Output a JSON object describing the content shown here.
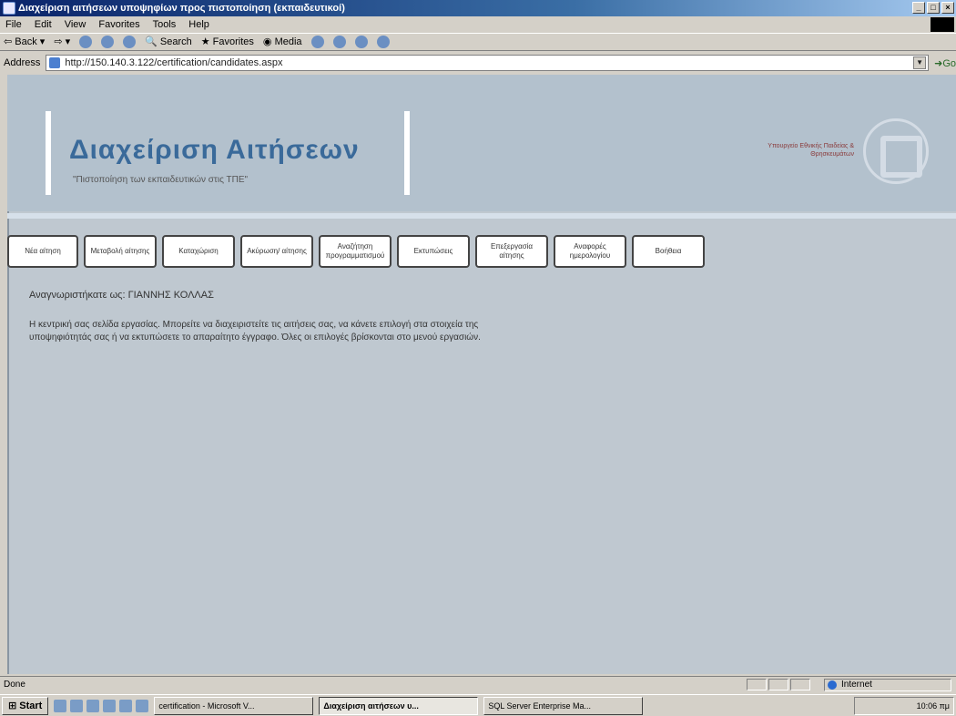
{
  "window": {
    "title": "Διαχείριση αιτήσεων υποψηφίων προς πιστοποίηση (εκπαιδευτικοί)",
    "controls": [
      "_",
      "□",
      "×"
    ]
  },
  "menu": [
    "File",
    "Edit",
    "View",
    "Favorites",
    "Tools",
    "Help"
  ],
  "toolbar": {
    "back": "Back",
    "search": "Search",
    "favorites": "Favorites",
    "media": "Media"
  },
  "address": {
    "label": "Address",
    "url": "http://150.140.3.122/certification/candidates.aspx",
    "go": "Go"
  },
  "header": {
    "title": "Διαχείριση Αιτήσεων",
    "subtitle": "\"Πιστοποίηση των εκπαιδευτικών στις ΤΠΕ\"",
    "ministry": "Υπουργείο Εθνικής Παιδείας & Θρησκευμάτων"
  },
  "nav": [
    {
      "label": "Νέα αίτηση"
    },
    {
      "label": "Μεταβολή αίτησης"
    },
    {
      "label": "Καταχώριση"
    },
    {
      "label": "Ακύρωση/ αίτησης"
    },
    {
      "label": "Αναζήτηση προγραμματισμού"
    },
    {
      "label": "Εκτυπώσεις"
    },
    {
      "label": "Επεξεργασία αίτησης"
    },
    {
      "label": "Αναφορές ημερολογίου"
    },
    {
      "label": "Βοήθεια"
    }
  ],
  "main": {
    "greeting": "Αναγνωριστήκατε ως: ΓΙΑΝΝΗΣ  ΚΟΛΛΑΣ",
    "intro": "Η κεντρική σας σελίδα εργασίας. Μπορείτε να διαχειριστείτε τις αιτήσεις σας, να κάνετε επιλογή στα στοιχεία της υποψηφιότητάς σας ή να εκτυπώσετε το απαραίτητο έγγραφο. Όλες οι επιλογές βρίσκονται στο μενού εργασιών."
  },
  "status": {
    "text": "Done",
    "zone": "Internet"
  },
  "taskbar": {
    "start": "Start",
    "tasks": [
      {
        "label": "certification - Microsoft V...",
        "active": false
      },
      {
        "label": "Διαχείριση αιτήσεων υ...",
        "active": true
      },
      {
        "label": "SQL Server Enterprise Ma...",
        "active": false
      }
    ],
    "time": "10:06 πμ"
  }
}
